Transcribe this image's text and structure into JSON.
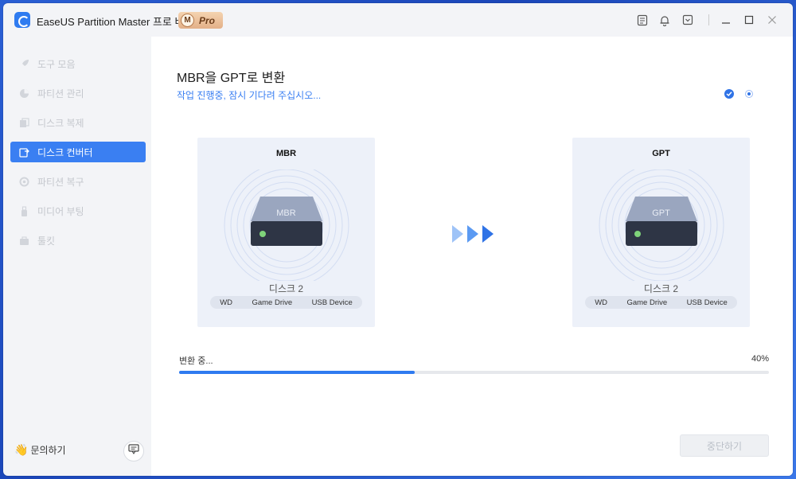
{
  "app": {
    "title": "EaseUS Partition Master 프로 버전",
    "badge_letter": "M",
    "badge_text": "Pro"
  },
  "titlebar": {
    "icons": [
      "notes-icon",
      "bell-icon",
      "download-icon"
    ],
    "window_controls": [
      "minimize-icon",
      "maximize-icon",
      "close-icon"
    ]
  },
  "sidebar": {
    "items": [
      {
        "label": "도구 모음",
        "icon": "rocket-icon",
        "active": false
      },
      {
        "label": "파티션 관리",
        "icon": "pie-icon",
        "active": false
      },
      {
        "label": "디스크 복제",
        "icon": "clone-icon",
        "active": false
      },
      {
        "label": "디스크 컨버터",
        "icon": "convert-icon",
        "active": true
      },
      {
        "label": "파티션 복구",
        "icon": "recover-icon",
        "active": false
      },
      {
        "label": "미디어 부팅",
        "icon": "usb-icon",
        "active": false
      },
      {
        "label": "툴킷",
        "icon": "toolkit-icon",
        "active": false
      }
    ],
    "help_label": "문의하기"
  },
  "main": {
    "title": "MBR을 GPT로 변환",
    "subtitle": "작업 진행중, 잠시 기다려 주십시오...",
    "source": {
      "title": "MBR",
      "disk_label": "MBR",
      "disk_name": "디스크 2",
      "info": [
        "WD",
        "Game Drive",
        "USB Device"
      ]
    },
    "target": {
      "title": "GPT",
      "disk_label": "GPT",
      "disk_name": "디스크 2",
      "info": [
        "WD",
        "Game Drive",
        "USB Device"
      ]
    },
    "progress": {
      "label": "변환 중...",
      "percent_text": "40%",
      "value": 0.4
    },
    "stop_label": "중단하기"
  },
  "colors": {
    "accent": "#3a7ff2",
    "progress": "#2f7bf0",
    "card_bg": "#edf1f9"
  }
}
